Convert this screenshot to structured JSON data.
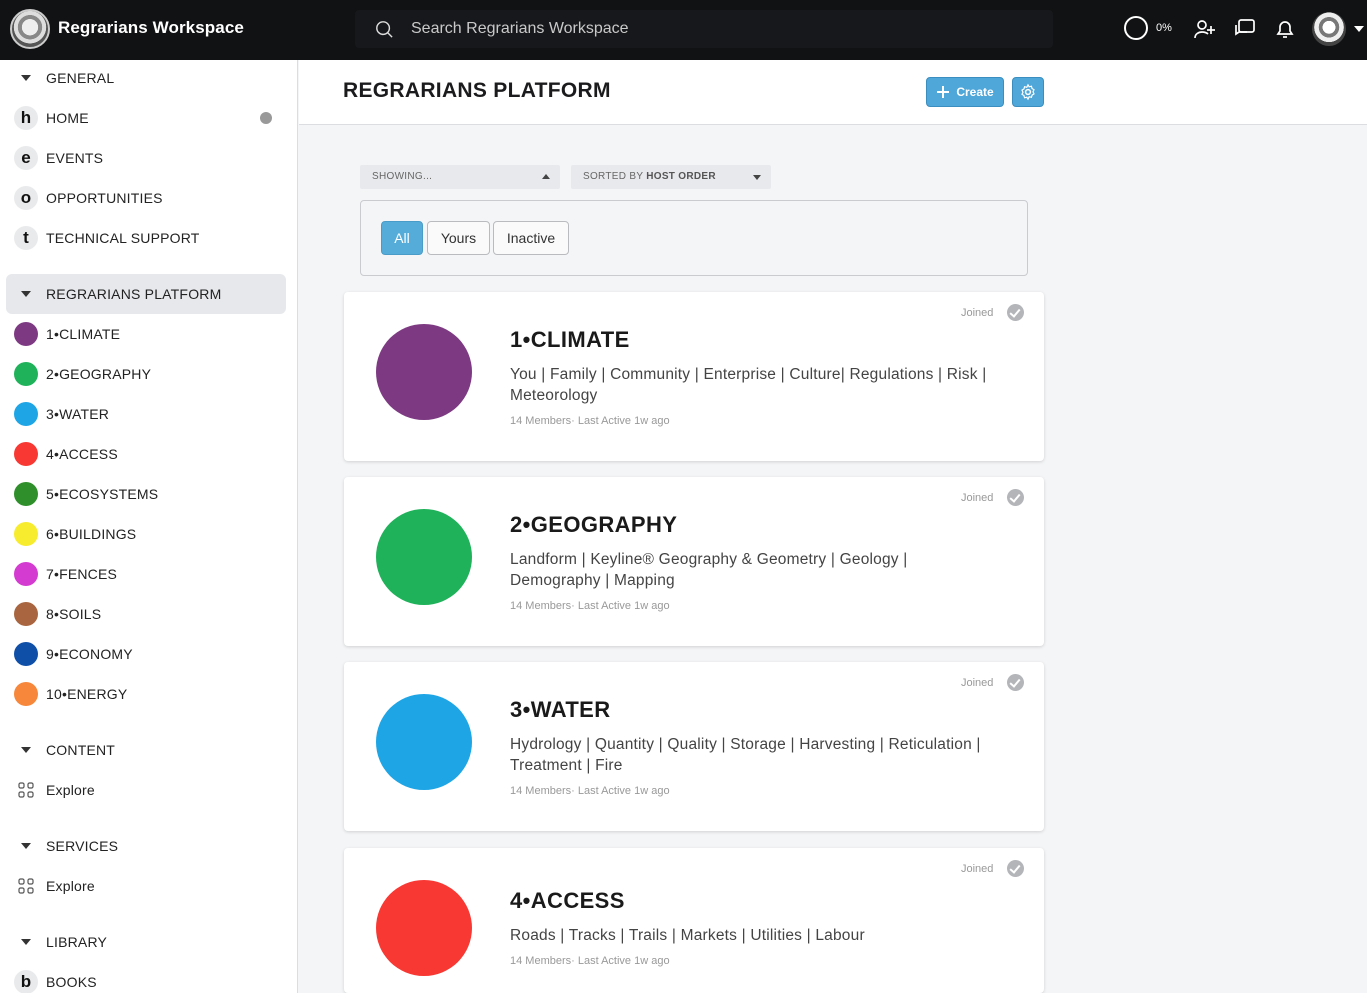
{
  "app": {
    "title": "Regrarians Workspace"
  },
  "search": {
    "placeholder": "Search Regrarians Workspace"
  },
  "top": {
    "progress_label": "0%"
  },
  "sidebar": {
    "general": {
      "label": "GENERAL",
      "items": [
        {
          "letter": "h",
          "label": "HOME"
        },
        {
          "letter": "e",
          "label": "EVENTS"
        },
        {
          "letter": "o",
          "label": "OPPORTUNITIES"
        },
        {
          "letter": "t",
          "label": "TECHNICAL SUPPORT"
        }
      ]
    },
    "platform": {
      "label": "REGRARIANS PLATFORM",
      "items": [
        {
          "label": "1•CLIMATE",
          "color": "#7d3a82"
        },
        {
          "label": "2•GEOGRAPHY",
          "color": "#1fb25a"
        },
        {
          "label": "3•WATER",
          "color": "#1ea5e6"
        },
        {
          "label": "4•ACCESS",
          "color": "#f83832"
        },
        {
          "label": "5•ECOSYSTEMS",
          "color": "#2f8f2a"
        },
        {
          "label": "6•BUILDINGS",
          "color": "#f7ec2e"
        },
        {
          "label": "7•FENCES",
          "color": "#d43bd0"
        },
        {
          "label": "8•SOILS",
          "color": "#a8653f"
        },
        {
          "label": "9•ECONOMY",
          "color": "#0f4fa8"
        },
        {
          "label": "10•ENERGY",
          "color": "#f7873a"
        }
      ]
    },
    "content": {
      "label": "CONTENT",
      "explore": "Explore"
    },
    "services": {
      "label": "SERVICES",
      "explore": "Explore"
    },
    "library": {
      "label": "LIBRARY",
      "items": [
        {
          "letter": "b",
          "label": "BOOKS"
        }
      ]
    }
  },
  "main": {
    "title": "REGRARIANS PLATFORM",
    "create_label": "Create",
    "showing_label": "SHOWING...",
    "sorted_prefix": "SORTED BY ",
    "sorted_value": "HOST ORDER",
    "filters": [
      "All",
      "Yours",
      "Inactive"
    ],
    "cards": [
      {
        "title": "1•CLIMATE",
        "desc": "You | Family | Community | Enterprise | Culture| Regulations | Risk | Meteorology",
        "meta": "14 Members· Last Active 1w ago",
        "joined": "Joined",
        "color": "#7d3a82"
      },
      {
        "title": "2•GEOGRAPHY",
        "desc": "Landform | Keyline® Geography & Geometry | Geology | Demography | Mapping",
        "meta": "14 Members· Last Active 1w ago",
        "joined": "Joined",
        "color": "#1fb25a"
      },
      {
        "title": "3•WATER",
        "desc": "Hydrology | Quantity | Quality | Storage | Harvesting | Reticulation | Treatment | Fire",
        "meta": "14 Members· Last Active 1w ago",
        "joined": "Joined",
        "color": "#1ea5e6"
      },
      {
        "title": "4•ACCESS",
        "desc": "Roads | Tracks | Trails | Markets | Utilities | Labour",
        "meta": "14 Members· Last Active 1w ago",
        "joined": "Joined",
        "color": "#f83832"
      }
    ]
  },
  "colors": {
    "accent": "#4ea6d9",
    "topbar": "#111214"
  }
}
